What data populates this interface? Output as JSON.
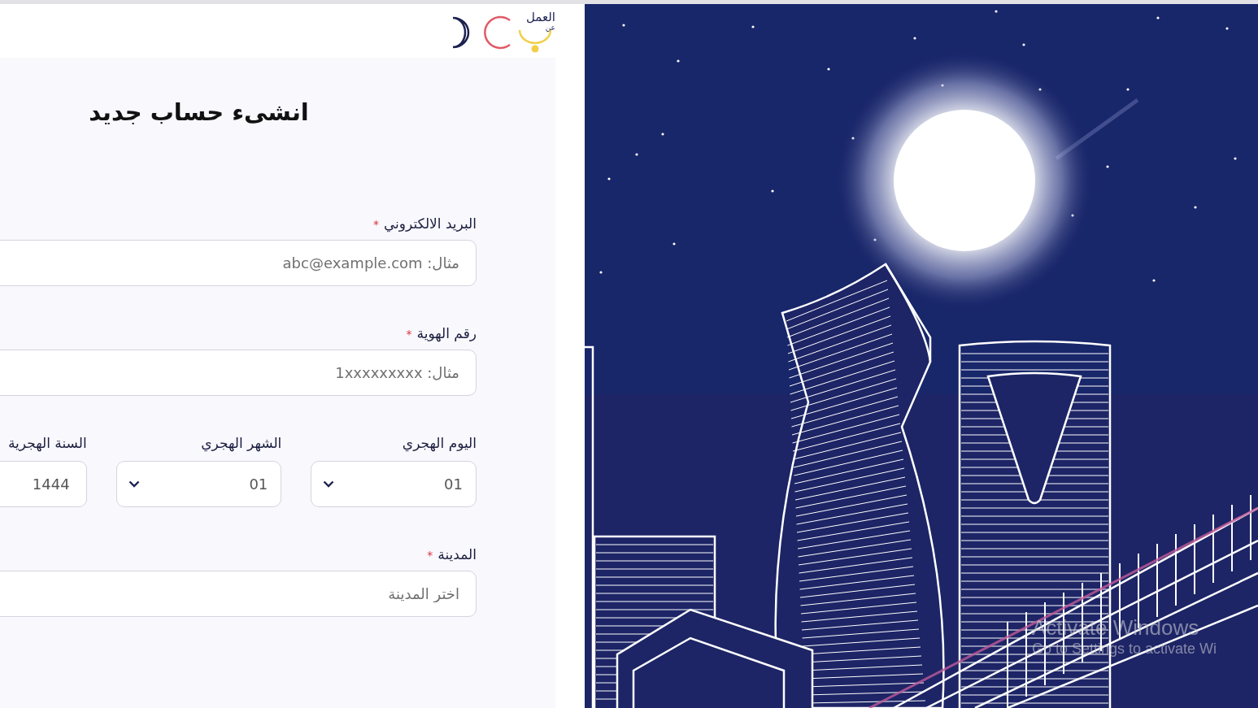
{
  "header": {
    "logo_text": "العمل",
    "logo_subtext": "عن"
  },
  "form": {
    "title": "انشىء حساب جديد",
    "required_mark": "*",
    "fields": [
      {
        "kind": "text",
        "label": "البريد الالكتروني",
        "required": true,
        "placeholder": "مثال: abc@example.com"
      },
      {
        "kind": "text",
        "label": "رقم الهوية",
        "required": true,
        "placeholder": "مثال: 1xxxxxxxxx"
      },
      {
        "kind": "date_group",
        "parts": [
          {
            "kind": "select",
            "label": "اليوم الهجري",
            "value": "01"
          },
          {
            "kind": "select",
            "label": "الشهر الهجري",
            "value": "01"
          },
          {
            "kind": "text",
            "label": "السنة الهجرية",
            "value": "1444"
          }
        ]
      },
      {
        "kind": "text",
        "label": "المدينة",
        "required": true,
        "placeholder": "اختر المدينة"
      }
    ]
  },
  "os_overlay": {
    "title": "Activate Windows",
    "subtitle": "Go to Settings to activate Wi"
  }
}
